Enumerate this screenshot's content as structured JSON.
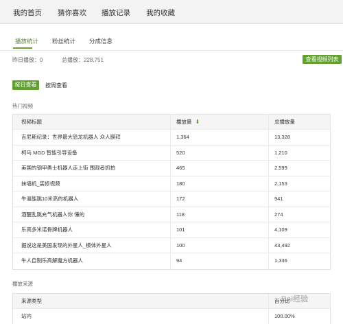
{
  "topnav": {
    "items": [
      {
        "label": "我的首页"
      },
      {
        "label": "猜你喜欢"
      },
      {
        "label": "播放记录"
      },
      {
        "label": "我的收藏"
      }
    ]
  },
  "subtabs": {
    "items": [
      {
        "label": "播放统计",
        "active": true
      },
      {
        "label": "粉丝统计",
        "active": false
      },
      {
        "label": "分成信息",
        "active": false
      }
    ]
  },
  "stats": {
    "yesterday": "昨日播放：0",
    "total": "总播放：228,751"
  },
  "buttons": {
    "video_list": "查看视频列表",
    "by_day": "按日查看",
    "by_week": "按周查看"
  },
  "hot_videos": {
    "title": "热门视频",
    "headers": [
      "视频标题",
      "播放量",
      "总播放量"
    ],
    "rows": [
      [
        "吉尼斯纪录：世界最大恐龙机器人 众人膜拜",
        "1,364",
        "13,328"
      ],
      [
        "柯马 MGD 智能引导设备",
        "520",
        "1,210"
      ],
      [
        "美国的钢甲勇士机器人走上街 围观者抓拍",
        "465",
        "2,599"
      ],
      [
        "抹墙机_装修视频",
        "180",
        "2,153"
      ],
      [
        "牛逼能跳10米高的机器人",
        "172",
        "941"
      ],
      [
        "酒醒乱跳充气机器人你 懂的",
        "118",
        "274"
      ],
      [
        "乐高多米诺骨牌机器人",
        "101",
        "4,109"
      ],
      [
        "据说这是美国发现的外星人_模体外星人",
        "100",
        "43,492"
      ],
      [
        "牛人自制乐高解魔方机器人",
        "94",
        "1,336"
      ]
    ]
  },
  "play_source": {
    "title": "播放来源",
    "headers": [
      "来源类型",
      "百分比"
    ],
    "rows": [
      [
        "站内",
        "100.00%"
      ]
    ]
  },
  "watermark": "Bai经验",
  "colors": {
    "accent": "#62a12f",
    "nav_bg": "#f3f3f3",
    "header_bg": "#f5f5f5"
  }
}
